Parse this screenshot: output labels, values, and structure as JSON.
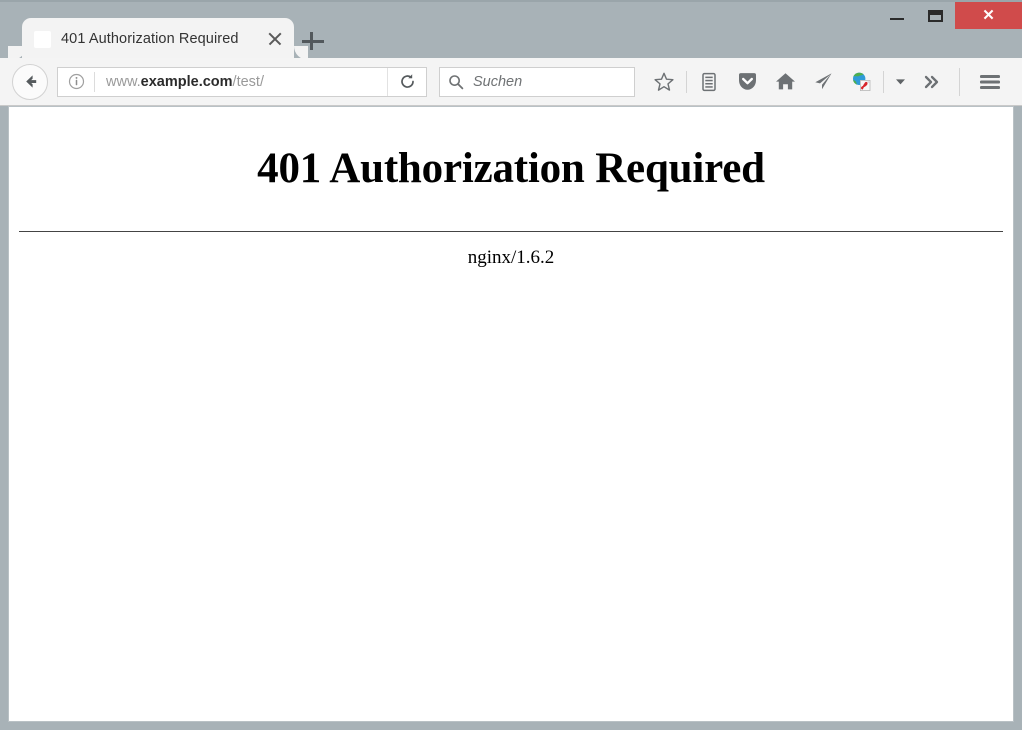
{
  "window": {
    "controls": {
      "minimize_label": "–",
      "maximize_label": "□",
      "close_label": "✕"
    },
    "frame_color": "#a8b2b7",
    "close_button_color": "#d04b4b"
  },
  "tabs": {
    "active_index": 0,
    "items": [
      {
        "title": "401 Authorization Required",
        "favicon": "blank-favicon",
        "close_label": "✕"
      }
    ],
    "new_tab_label": "+"
  },
  "toolbar": {
    "back_icon": "back-arrow-icon",
    "url": {
      "prefix": "www.",
      "host": "example.com",
      "path": "/test/",
      "full": "www.example.com/test/",
      "identity_icon": "info-circle-icon",
      "reload_icon": "reload-icon"
    },
    "search": {
      "placeholder": "Suchen",
      "icon": "search-icon"
    },
    "buttons": [
      {
        "name": "bookmark-star-button",
        "icon": "star-icon"
      },
      {
        "name": "reading-list-button",
        "icon": "reading-list-icon"
      },
      {
        "name": "pocket-button",
        "icon": "pocket-shield-icon"
      },
      {
        "name": "home-button",
        "icon": "home-icon"
      },
      {
        "name": "send-button",
        "icon": "paper-plane-icon"
      },
      {
        "name": "web-to-pdf-button",
        "icon": "globe-pdf-icon"
      },
      {
        "name": "web-to-pdf-dropdown",
        "icon": "chevron-down-icon"
      },
      {
        "name": "overflow-button",
        "icon": "double-chevron-right-icon"
      },
      {
        "name": "menu-button",
        "icon": "hamburger-menu-icon"
      }
    ]
  },
  "page": {
    "heading": "401 Authorization Required",
    "server_signature": "nginx/1.6.2",
    "background": "#ffffff",
    "text_color": "#000000"
  }
}
